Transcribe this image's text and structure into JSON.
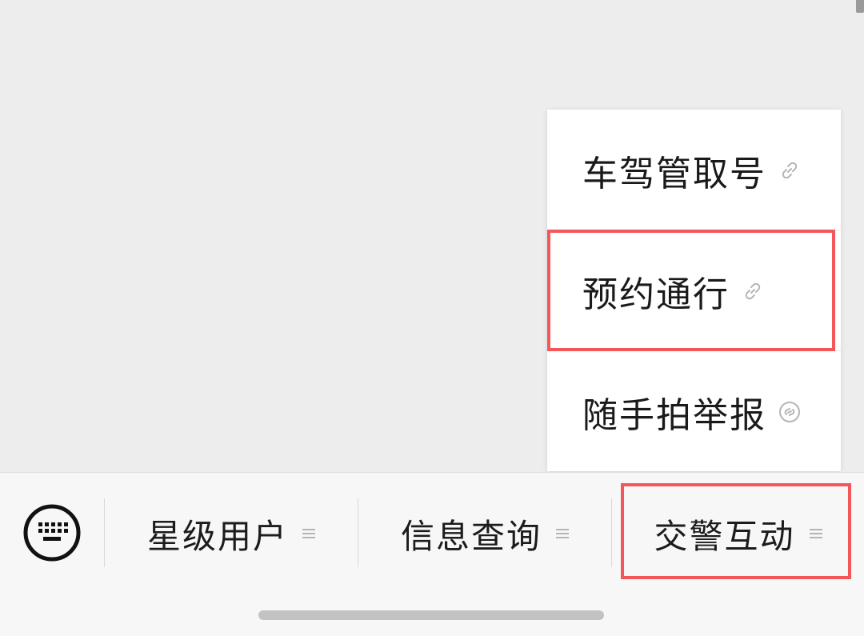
{
  "popup_menu": {
    "items": [
      {
        "label": "车驾管取号",
        "icon": "link-icon"
      },
      {
        "label": "预约通行",
        "icon": "link-icon"
      },
      {
        "label": "随手拍举报",
        "icon": "mini-program-icon"
      }
    ]
  },
  "bottom_bar": {
    "keyboard_icon": "keyboard-icon",
    "tabs": [
      {
        "label": "星级用户",
        "icon": "menu-icon"
      },
      {
        "label": "信息查询",
        "icon": "menu-icon"
      },
      {
        "label": "交警互动",
        "icon": "menu-icon"
      }
    ]
  },
  "colors": {
    "background": "#ededed",
    "popup_background": "#ffffff",
    "bottom_bar_background": "#f7f7f7",
    "highlight": "#f25759",
    "icon_gray": "#b5b5b5",
    "text": "#1a1a1a"
  }
}
